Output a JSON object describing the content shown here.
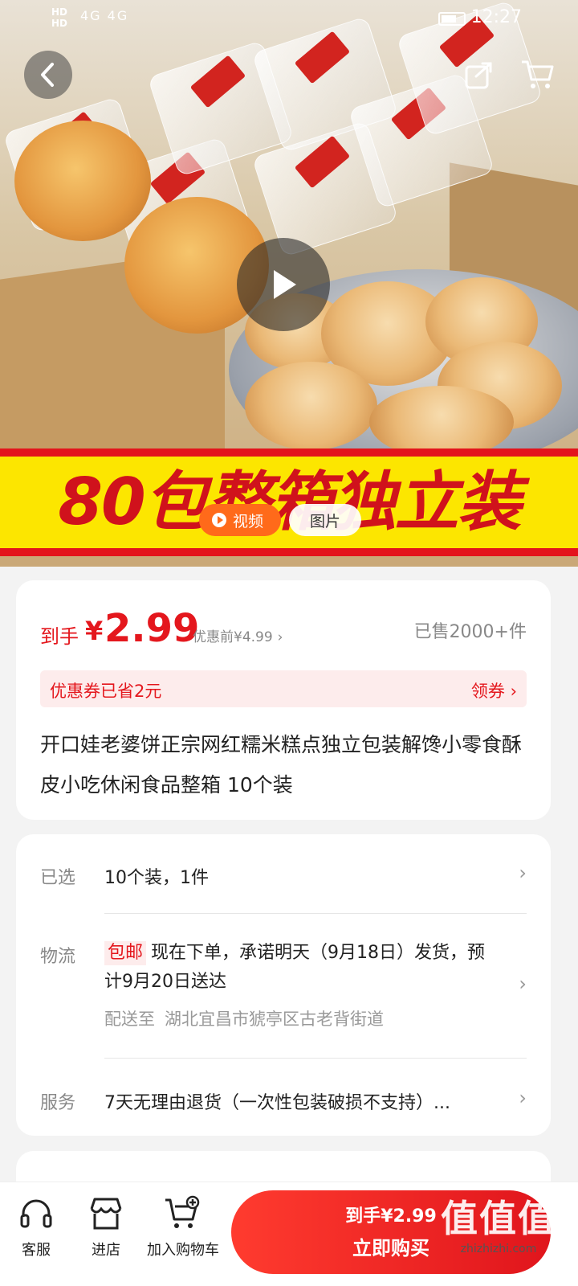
{
  "status": {
    "hd_labels": [
      "HD",
      "HD"
    ],
    "signal": "4G 4G",
    "time": "12:27"
  },
  "hero": {
    "banner_text": "80包整箱独立装",
    "video_label": "视频",
    "image_label": "图片"
  },
  "price_card": {
    "price_prefix": "到手",
    "currency": "¥",
    "price": "2.99",
    "original_price": "优惠前¥4.99",
    "sold": "已售2000+件",
    "coupon_text": "优惠券已省2元",
    "coupon_action": "领券",
    "title": "开口娃老婆饼正宗网红糯米糕点独立包装解馋小零食酥皮小吃休闲食品整箱 10个装"
  },
  "info_card": {
    "selected_label": "已选",
    "selected_value": "10个装，1件",
    "logistics_label": "物流",
    "free_shipping": "包邮",
    "logistics_text": "现在下单，承诺明天（9月18日）发货，预计9月20日送达",
    "deliver_label": "配送至",
    "deliver_address": "湖北宜昌市猇亭区古老背街道",
    "service_label": "服务",
    "service_text": "7天无理由退货（一次性包装破损不支持）..."
  },
  "bottom_bar": {
    "service_label": "客服",
    "shop_label": "进店",
    "cart_label": "加入购物车",
    "buy_price": "到手¥2.99",
    "buy_label": "立即购买"
  },
  "watermark": {
    "main": "值值值",
    "sub": "zhizhizhi.com"
  },
  "colors": {
    "accent_red": "#e4171d",
    "video_orange": "#ff6a1a",
    "banner_yellow": "#fce600"
  }
}
